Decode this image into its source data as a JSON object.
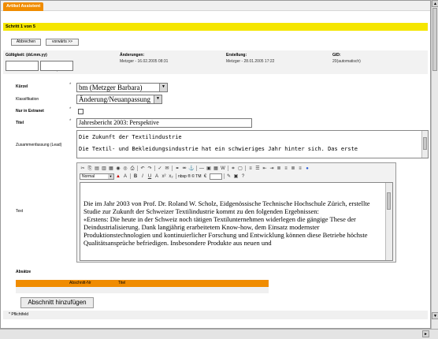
{
  "tab": {
    "label": "Artikel Assistent"
  },
  "step": {
    "label": "Schritt 1 von 5"
  },
  "nav": {
    "cancel": "Abbrechen",
    "next": "vorwärts >>"
  },
  "meta": {
    "validity_label": "Gültigkeit: (dd.mm.yy)",
    "changes_label": "Änderungen:",
    "changes_value": "Metzger - 16.02.2005 08:31",
    "created_label": "Erstellung:",
    "created_value": "Metzger - 28.01.2005 17:22",
    "gid_label": "GID:",
    "gid_value": "20(automatisch)"
  },
  "form": {
    "kuerzel_label": "Kürzel",
    "kuerzel_value": "bm (Metzger Barbara)",
    "klass_label": "Klassifikation",
    "klass_value": "Änderung/Neuanpassung",
    "extranet_label": "Nur in Extranet",
    "title_label": "Titel",
    "title_value": "Jahresbericht 2003: Perspektive",
    "summary_label": "Zusammenfassung (Lead)",
    "summary_line1": "Die Zukunft der Textilindustrie",
    "summary_line2": "Die Textil- und Bekleidungsindustrie hat ein schwieriges Jahr hinter sich. Das erste",
    "text_label": "Text",
    "style_value": "Normal",
    "nbsp_label": "nbsp ® © TM",
    "editor_p1": "Die im Jahr 2003 von Prof. Dr. Roland W. Scholz, Eidgenössische Technische Hochschule Zürich, erstellte Studie zur Zukunft der Schweizer Textilindustrie kommt zu den folgenden Ergebnissen:",
    "editor_p2": "«Erstens: Die heute in der Schweiz noch tätigen Textilunternehmen widerlegen die gängige These der Deindustrialisierung. Dank langjährig erarbeitetem Know-how, dem Einsatz modernster Produktionstechnologien und kontinuierlicher Forschung und Entwicklung können diese Betriebe höchste Qualitätsansprüche befriedigen. Insbesondere Produkte aus neuen und"
  },
  "absaetze": {
    "label": "Absätze",
    "col_nr": "Abschnitt-Nr",
    "col_title": "Titel",
    "add_button": "Abschnitt hinzufügen"
  },
  "footer": {
    "required": "* Pflichtfeld"
  }
}
